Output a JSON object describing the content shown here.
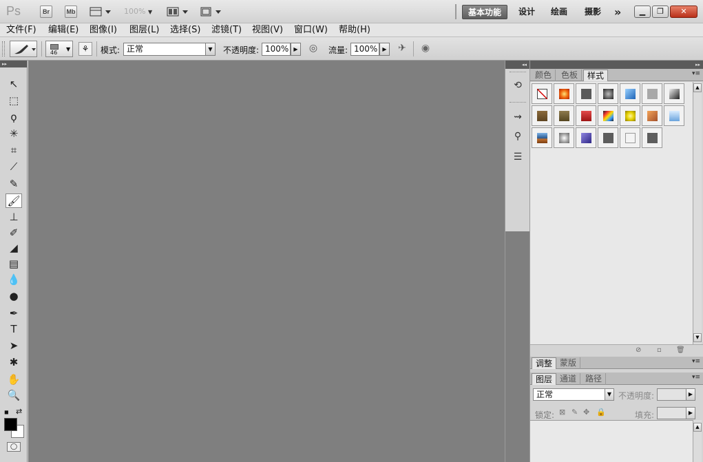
{
  "titlebar": {
    "logo": "Ps",
    "bridge_label": "Br",
    "minibridge_label": "Mb",
    "zoom": "100%",
    "workspaces": [
      "基本功能",
      "设计",
      "绘画",
      "摄影"
    ],
    "more": "»"
  },
  "menu": [
    "文件(F)",
    "编辑(E)",
    "图像(I)",
    "图层(L)",
    "选择(S)",
    "滤镜(T)",
    "视图(V)",
    "窗口(W)",
    "帮助(H)"
  ],
  "options": {
    "brush_size": "46",
    "mode_label": "模式:",
    "mode_value": "正常",
    "opacity_label": "不透明度:",
    "opacity_value": "100%",
    "flow_label": "流量:",
    "flow_value": "100%"
  },
  "tools": [
    {
      "name": "move-tool",
      "icon": "move-icon",
      "glyph": "↖"
    },
    {
      "name": "marquee-tool",
      "icon": "marquee-icon",
      "glyph": "⬚"
    },
    {
      "name": "lasso-tool",
      "icon": "lasso-icon",
      "glyph": "ϙ"
    },
    {
      "name": "quick-select-tool",
      "icon": "magic-wand-icon",
      "glyph": "✳"
    },
    {
      "name": "crop-tool",
      "icon": "crop-icon",
      "glyph": "⌗"
    },
    {
      "name": "eyedropper-tool",
      "icon": "eyedropper-icon",
      "glyph": "⟋"
    },
    {
      "name": "healing-tool",
      "icon": "bandage-icon",
      "glyph": "✎"
    },
    {
      "name": "brush-tool",
      "icon": "brush-icon",
      "glyph": "🖌"
    },
    {
      "name": "stamp-tool",
      "icon": "stamp-icon",
      "glyph": "⊥"
    },
    {
      "name": "history-brush-tool",
      "icon": "history-brush-icon",
      "glyph": "✐"
    },
    {
      "name": "eraser-tool",
      "icon": "eraser-icon",
      "glyph": "◢"
    },
    {
      "name": "gradient-tool",
      "icon": "gradient-icon",
      "glyph": "▤"
    },
    {
      "name": "blur-tool",
      "icon": "drop-icon",
      "glyph": "💧"
    },
    {
      "name": "dodge-tool",
      "icon": "dodge-icon",
      "glyph": "●"
    },
    {
      "name": "pen-tool",
      "icon": "pen-icon",
      "glyph": "✒"
    },
    {
      "name": "type-tool",
      "icon": "type-icon",
      "glyph": "T"
    },
    {
      "name": "path-select-tool",
      "icon": "arrow-icon",
      "glyph": "➤"
    },
    {
      "name": "shape-tool",
      "icon": "shape-icon",
      "glyph": "✱"
    },
    {
      "name": "hand-tool",
      "icon": "hand-icon",
      "glyph": "✋"
    },
    {
      "name": "zoom-tool",
      "icon": "zoom-icon",
      "glyph": "🔍"
    }
  ],
  "colors": {
    "foreground": "#000000",
    "background": "#ffffff",
    "canvas": "#7f7f7f",
    "accent": "#5e5e5e"
  },
  "styles_panel": {
    "tabs": [
      "颜色",
      "色板",
      "样式"
    ],
    "active_tab": "样式",
    "swatches": [
      "none-style",
      "orange-glow",
      "dark-square",
      "black-chrome",
      "blue-glass",
      "gray-flat",
      "black-gradient",
      "brown-wood",
      "olive-bronze",
      "red-stripe",
      "rainbow-mix",
      "yellow-glow",
      "orange-sunset",
      "blue-sky",
      "blue-orange",
      "crumpled-paper",
      "purple-glow",
      "dark-square-2",
      "white-square",
      "dark-square-3"
    ]
  },
  "adjustments_panel": {
    "tabs": [
      "调整",
      "蒙版"
    ]
  },
  "layers_panel": {
    "tabs": [
      "图层",
      "通道",
      "路径"
    ],
    "blend_mode": "正常",
    "opacity_label": "不透明度:",
    "lock_label": "锁定:",
    "fill_label": "填充:"
  }
}
